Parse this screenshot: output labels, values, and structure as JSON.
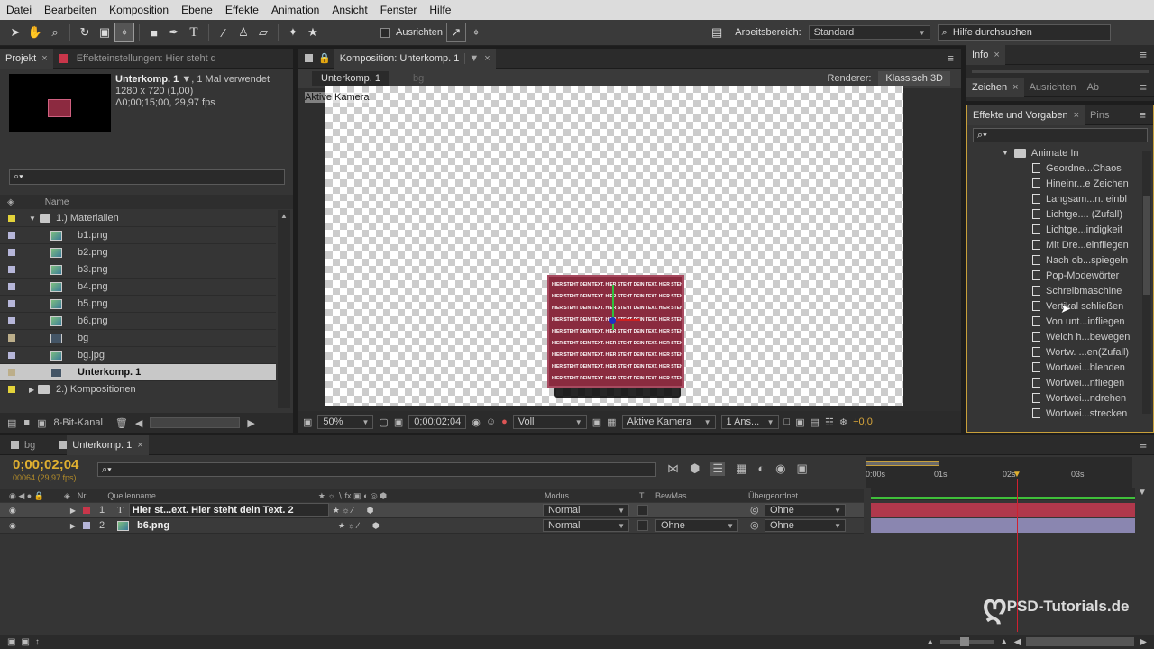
{
  "menu": [
    "Datei",
    "Bearbeiten",
    "Komposition",
    "Ebene",
    "Effekte",
    "Animation",
    "Ansicht",
    "Fenster",
    "Hilfe"
  ],
  "toolbar": {
    "ausrichten_label": "Ausrichten",
    "arbeitsbereich_label": "Arbeitsbereich:",
    "arbeitsbereich_value": "Standard",
    "help_search": "Hilfe durchsuchen"
  },
  "project": {
    "tab_label": "Projekt",
    "effects_tab_label": "Effekteinstellungen: Hier steht d",
    "item_name": "Unterkomp. 1",
    "item_usage": ", 1 Mal verwendet",
    "item_size": "1280 x 720 (1,00)",
    "item_duration": "Δ0;00;15;00, 29,97 fps",
    "col_name": "Name",
    "bit_depth": "8-Bit-Kanal",
    "items": [
      {
        "label": "1.) Materialien",
        "type": "folder",
        "color": "#e3d33a",
        "level": 0,
        "open": true
      },
      {
        "label": "b1.png",
        "type": "image",
        "color": "#b6b6d9",
        "level": 1
      },
      {
        "label": "b2.png",
        "type": "image",
        "color": "#b6b6d9",
        "level": 1
      },
      {
        "label": "b3.png",
        "type": "image",
        "color": "#b6b6d9",
        "level": 1
      },
      {
        "label": "b4.png",
        "type": "image",
        "color": "#b6b6d9",
        "level": 1
      },
      {
        "label": "b5.png",
        "type": "image",
        "color": "#b6b6d9",
        "level": 1
      },
      {
        "label": "b6.png",
        "type": "image",
        "color": "#b6b6d9",
        "level": 1
      },
      {
        "label": "bg",
        "type": "comp",
        "color": "#bcae8a",
        "level": 1
      },
      {
        "label": "bg.jpg",
        "type": "image",
        "color": "#b6b6d9",
        "level": 1
      },
      {
        "label": "Unterkomp. 1",
        "type": "comp",
        "color": "#bcae8a",
        "level": 1,
        "selected": true
      },
      {
        "label": "2.) Kompositionen",
        "type": "folder",
        "color": "#e3d33a",
        "level": 0,
        "open": false
      }
    ]
  },
  "comp": {
    "tab_label": "Komposition: Unterkomp. 1",
    "crumb_active": "Unterkomp. 1",
    "crumb_other": "bg",
    "renderer_label": "Renderer:",
    "renderer_value": "Klassisch 3D",
    "camera_label": "Aktive Kamera",
    "text_line": "HIER STEHT DEIN TEXT. HIER STEHT DEIN TEXT. HIER STEHT DEIN TEXT.",
    "zoom": "50%",
    "timecode": "0;00;02;04",
    "resolution": "Voll",
    "view": "Aktive Kamera",
    "views_count": "1 Ans...",
    "exposure": "+0,0"
  },
  "info_panel": {
    "tab_label": "Info"
  },
  "char_panel": {
    "tab_label": "Zeichen",
    "tab2": "Ausrichten",
    "tab3": "Ab"
  },
  "effects": {
    "tab_label": "Effekte und Vorgaben",
    "tab2": "Pins",
    "folder": "Animate In",
    "items": [
      "Geordne...Chaos",
      "Hineinr...e Zeichen",
      "Langsam...n. einbl",
      "Lichtge.... (Zufall)",
      "Lichtge...indigkeit",
      "Mit Dre...einfliegen",
      "Nach ob...spiegeln",
      "Pop-Modewörter",
      "Schreibmaschine",
      "Vertikal schließen",
      "Von unt...infliegen",
      "Weich h...bewegen",
      "Wortw. ...en(Zufall)",
      "Wortwei...blenden",
      "Wortwei...nfliegen",
      "Wortwei...ndrehen",
      "Wortwei...strecken"
    ]
  },
  "timeline": {
    "tab_bg": "bg",
    "tab_comp": "Unterkomp. 1",
    "timecode": "0;00;02;04",
    "frame_info": "00064 (29,97 fps)",
    "col_nr": "Nr.",
    "col_source": "Quellenname",
    "col_mode": "Modus",
    "col_t": "T",
    "col_bewmas": "BewMas",
    "col_parent": "Übergeordnet",
    "ruler": [
      "0:00s",
      "01s",
      "02s",
      "03s"
    ],
    "layers": [
      {
        "nr": "1",
        "name": "Hier st...ext. Hier steht dein Text. 2",
        "mode": "Normal",
        "bewmas": "",
        "parent": "Ohne",
        "color": "#c8364a",
        "type": "T"
      },
      {
        "nr": "2",
        "name": "b6.png",
        "mode": "Normal",
        "bewmas": "Ohne",
        "parent": "Ohne",
        "color": "#b6b6d9",
        "type": "img"
      }
    ]
  },
  "watermark": "PSD-Tutorials.de"
}
